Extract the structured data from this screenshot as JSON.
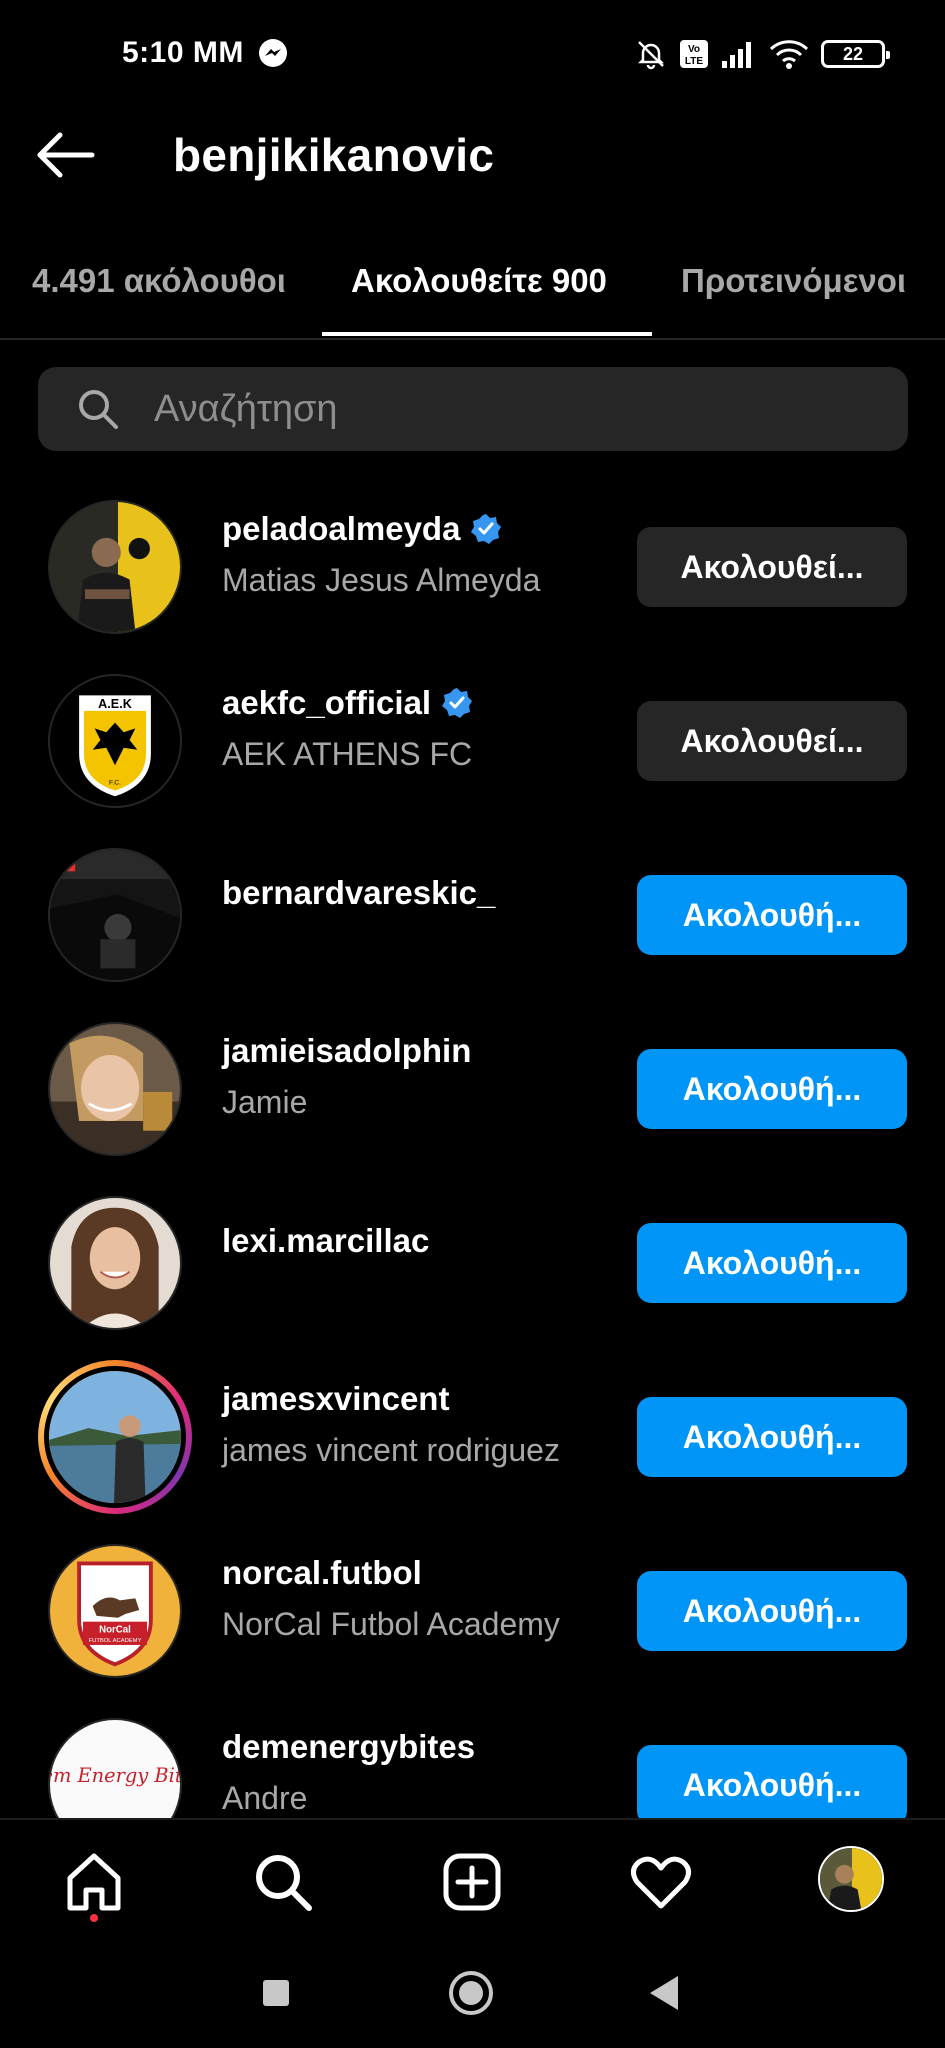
{
  "status_bar": {
    "time": "5:10 MM",
    "battery": "22",
    "icons": [
      "messenger-icon",
      "mute-icon",
      "volte-icon",
      "signal-icon",
      "wifi-icon",
      "battery-icon"
    ]
  },
  "header": {
    "title": "benjikikanovic",
    "back_icon": "arrow-left-icon"
  },
  "tabs": [
    {
      "label": "4.491 ακόλουθοι",
      "active": false
    },
    {
      "label": "Ακολουθείτε 900",
      "active": true
    },
    {
      "label": "Προτεινόμενοι",
      "active": false
    }
  ],
  "search": {
    "placeholder": "Αναζήτηση",
    "value": ""
  },
  "accounts": [
    {
      "username": "peladoalmeyda",
      "verified": true,
      "full_name": "Matias Jesus Almeyda",
      "button": "Ακολουθεί...",
      "button_style": "gray"
    },
    {
      "username": "aekfc_official",
      "verified": true,
      "full_name": "AEK ATHENS FC",
      "button": "Ακολουθεί...",
      "button_style": "gray"
    },
    {
      "username": "bernardvareskic_",
      "verified": false,
      "full_name": "",
      "button": "Ακολουθή...",
      "button_style": "blue"
    },
    {
      "username": "jamieisadolphin",
      "verified": false,
      "full_name": "Jamie",
      "button": "Ακολουθή...",
      "button_style": "blue"
    },
    {
      "username": "lexi.marcillac",
      "verified": false,
      "full_name": "",
      "button": "Ακολουθή...",
      "button_style": "blue"
    },
    {
      "username": "jamesxvincent",
      "verified": false,
      "full_name": "james vincent rodriguez",
      "button": "Ακολουθή...",
      "button_style": "blue",
      "story_ring": true
    },
    {
      "username": "norcal.futbol",
      "verified": false,
      "full_name": "NorCal Futbol Academy",
      "button": "Ακολουθή...",
      "button_style": "blue"
    },
    {
      "username": "demenergybites",
      "verified": false,
      "full_name": "Andre",
      "button": "Ακολουθή...",
      "button_style": "blue"
    }
  ],
  "avatar_text": {
    "aek_crest": "Α.Ε.Κ",
    "aek_crest_footer": "F.C.",
    "norcal_crest": "NorCal",
    "norcal_crest_sub": "FUTBOL ACADEMY",
    "dem_energy_logo": "Dem Energy Bites"
  },
  "bottom_nav": {
    "items": [
      "home-icon",
      "search-icon",
      "create-post-icon",
      "activity-heart-icon",
      "profile-avatar"
    ],
    "active": "home-icon"
  },
  "colors": {
    "background": "#000000",
    "surface": "#262626",
    "accent_blue": "#0095f6",
    "secondary_text": "#a8a8a8",
    "verified_blue": "#3797f0",
    "notification_dot": "#ff3040"
  }
}
